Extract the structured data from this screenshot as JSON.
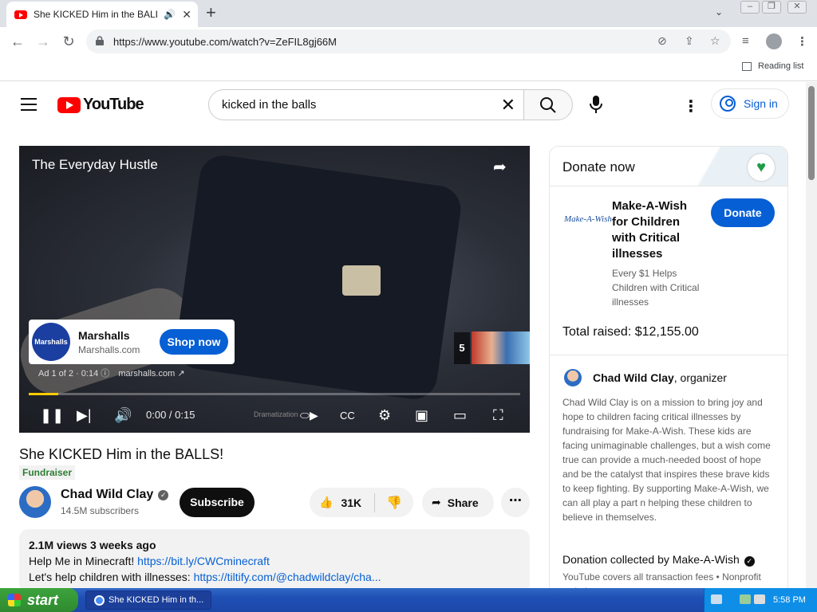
{
  "browser": {
    "tab_title": "She KICKED Him in the BALLS!",
    "tab_audio_icon": "speaker-icon",
    "new_tab_label": "+",
    "url": "https://www.youtube.com/watch?v=ZeFIL8gj66M",
    "reading_list": "Reading list"
  },
  "youtube": {
    "logo_text": "YouTube",
    "search_query": "kicked in the balls",
    "sign_in": "Sign in"
  },
  "player": {
    "channel_overlay": "The Everyday Hustle",
    "ad": {
      "logo_text": "Marshalls",
      "name": "Marshalls",
      "domain": "Marshalls.com",
      "cta": "Shop now",
      "info": "Ad 1 of 2 · 0:14",
      "link": "marshalls.com"
    },
    "skip_count": "5",
    "time": "0:00 / 0:15",
    "dramatization": "Dramatization",
    "progress_fraction": 0.06
  },
  "video": {
    "title": "She KICKED Him in the BALLS!",
    "badge": "Fundraiser",
    "channel": "Chad Wild Clay",
    "subscribers": "14.5M subscribers",
    "subscribe": "Subscribe",
    "likes": "31K",
    "share": "Share",
    "views_age": "2.1M views  3 weeks ago",
    "desc_line1_text": "Help Me in Minecraft! ",
    "desc_line1_link": "https://bit.ly/CWCminecraft",
    "desc_line2_text": "Let's help children with illnesses: ",
    "desc_line2_link": "https://tiltify.com/@chadwildclay/cha..."
  },
  "donate": {
    "header": "Donate now",
    "org_logo": "Make-A-Wish",
    "org_title": "Make-A-Wish for Children with Critical illnesses",
    "org_subtitle": "Every $1 Helps Children with Critical illnesses",
    "button": "Donate",
    "raised": "Total raised: $12,155.00",
    "organizer_name": "Chad Wild Clay",
    "organizer_role": ", organizer",
    "description": "Chad Wild Clay is on a mission to bring joy and hope to children facing critical illnesses by fundraising for Make-A-Wish. These kids are facing unimaginable challenges, but a wish come true can provide a much-needed boost of hope and be the catalyst that inspires these brave kids to keep fighting. By supporting Make-A-Wish, we can all play a part n helping these children to believe in themselves.",
    "collected": "Donation collected by Make-A-Wish",
    "fees": "YouTube covers all transaction fees  •  Nonprofit website"
  },
  "taskbar": {
    "start": "start",
    "window": "She KICKED Him in th...",
    "clock": "5:58 PM"
  }
}
